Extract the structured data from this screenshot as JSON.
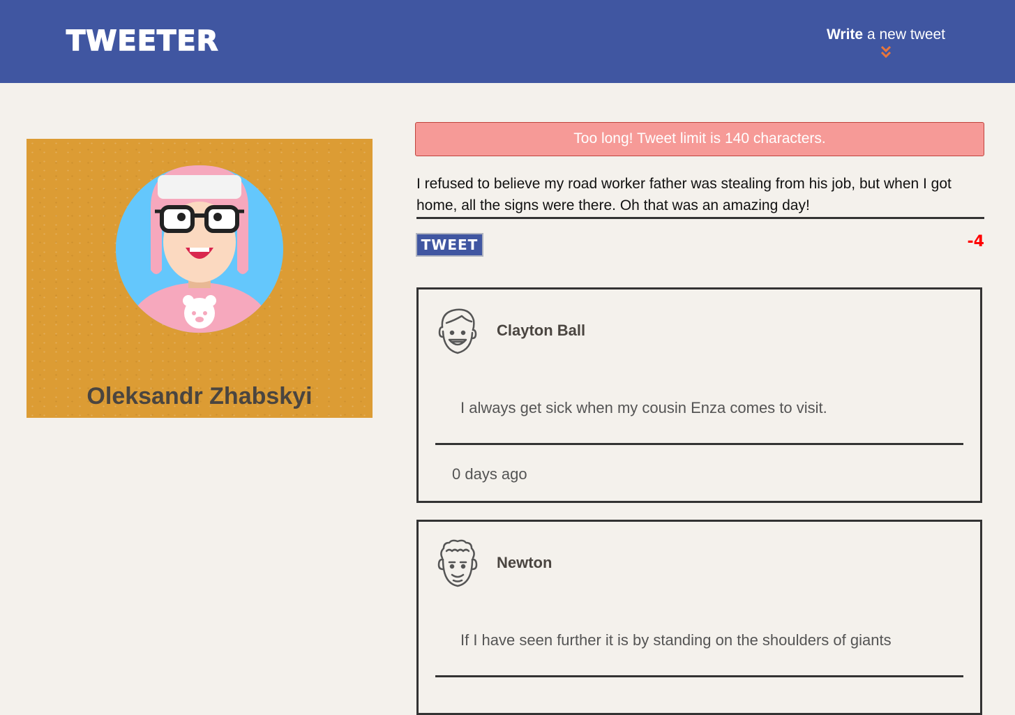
{
  "header": {
    "brand": "TWEETER",
    "compose_strong": "Write",
    "compose_rest": " a new tweet",
    "compose_icon": "double-chevron-down-icon",
    "accent_color": "#e8763c"
  },
  "profile": {
    "name": "Oleksandr Zhabskyi",
    "avatar": "avatar-girl-pink-hat-icon"
  },
  "composer": {
    "error": "Too long! Tweet limit is 140 characters.",
    "text": "I refused to believe my road worker father was stealing from his job, but when I got home, all the signs were there. Oh that was an amazing day!",
    "button_label": "TWEET",
    "counter": "-4"
  },
  "tweets": [
    {
      "author": "Clayton Ball",
      "avatar": "smiling-man-avatar-icon",
      "content": "I always get sick when my cousin Enza comes to visit.",
      "posted": "0 days ago"
    },
    {
      "author": "Newton",
      "avatar": "curly-hair-man-avatar-icon",
      "content": "If I have seen further it is by standing on the shoulders of giants"
    }
  ],
  "colors": {
    "nav": "#4056a1",
    "page_bg": "#f4f1ec",
    "profile_bg": "#dc9c34",
    "error_bg": "#f69a97",
    "counter": "#ff0000"
  }
}
